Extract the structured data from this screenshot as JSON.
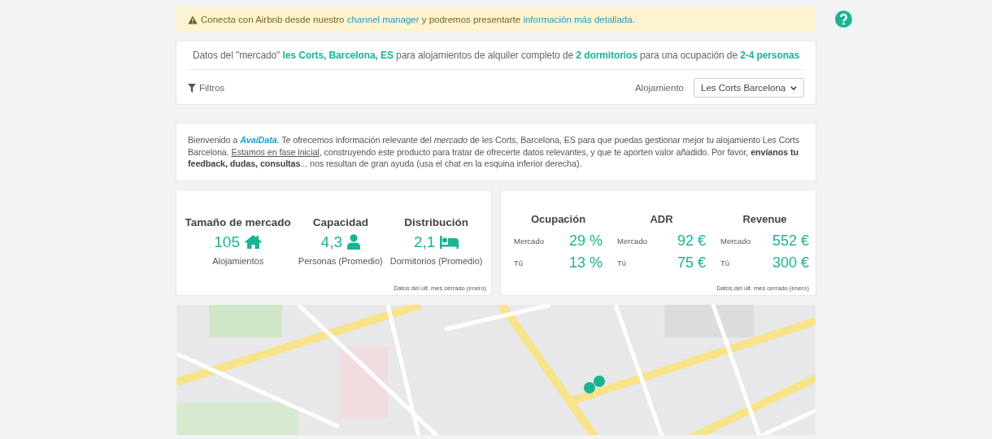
{
  "banner": {
    "parts": [
      {
        "kind": "text",
        "text": "Conecta con Airbnb desde nuestro "
      },
      {
        "kind": "link",
        "text": "channel manager"
      },
      {
        "kind": "text",
        "text": " y podremos presentarte "
      },
      {
        "kind": "link",
        "text": "información más detallada"
      },
      {
        "kind": "text",
        "text": "."
      }
    ]
  },
  "header": {
    "summary": "Datos del \"mercado\" **les Corts, Barcelona, ES** para alojamientos de alquiler completo de **2 dormitorios** para una ocupación de **2-4 personas**",
    "filters": "Filtros",
    "select_label": "Alojamiento",
    "select_value": "Les Corts Barcelona"
  },
  "welcome": {
    "parts": [
      {
        "kind": "text",
        "text": "Bienvenido a "
      },
      {
        "kind": "link",
        "text": "AvaiData"
      },
      {
        "kind": "text",
        "text": ". Te ofrecemos información relevante del "
      },
      {
        "kind": "em",
        "text": "mercado"
      },
      {
        "kind": "text",
        "text": " de les Corts, Barcelona, ES para que puedas gestionar mejor tu alojamiento Les Corts Barcelona. "
      },
      {
        "kind": "underline",
        "text": "Estamos en fase inicial"
      },
      {
        "kind": "text",
        "text": ", construyendo este producto para tratar de ofrecerte datos relevantes, y que te aporten valor añadido. Por favor, "
      },
      {
        "kind": "strong",
        "text": "envíanos tu feedback, dudas, consultas"
      },
      {
        "kind": "text",
        "text": "... nos resultan de gran ayuda (usa el chat en la esquina inferior derecha)."
      }
    ]
  },
  "market": {
    "items": [
      {
        "title": "Tamaño de mercado",
        "value": "105",
        "kind": "house",
        "caption": "Alojamientos"
      },
      {
        "title": "Capacidad",
        "value": "4,3",
        "kind": "person",
        "caption": "Personas (Promedio)"
      },
      {
        "title": "Distribución",
        "value": "2,1",
        "kind": "bed",
        "caption": "Dormitorios (Promedio)"
      }
    ],
    "footnote": "Datos del últ. mes cerrado (enero)"
  },
  "performance": {
    "columns": [
      {
        "title": "Ocupación",
        "rows": [
          {
            "label": "Mercado",
            "value": "29 %"
          },
          {
            "label": "Tú",
            "value": "13 %"
          }
        ]
      },
      {
        "title": "ADR",
        "rows": [
          {
            "label": "Mercado",
            "value": "92 €"
          },
          {
            "label": "Tú",
            "value": "75 €"
          }
        ]
      },
      {
        "title": "Revenue",
        "rows": [
          {
            "label": "Mercado",
            "value": "552 €"
          },
          {
            "label": "Tú",
            "value": "300 €"
          }
        ]
      }
    ],
    "footnote": "Datos del últ. mes cerrado (enero)"
  }
}
